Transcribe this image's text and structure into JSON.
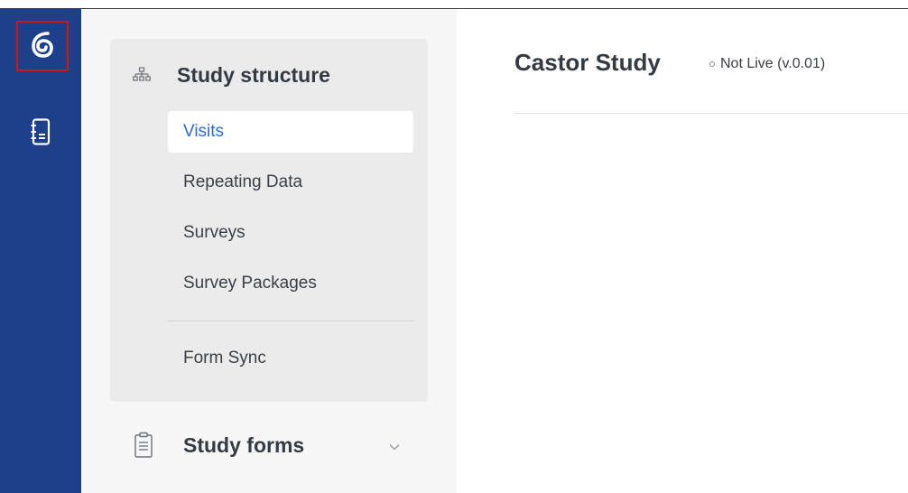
{
  "colors": {
    "rail": "#1e3f8a",
    "accent": "#2f6cd1",
    "highlight_border": "#d0151c"
  },
  "rail": {
    "logo_icon": "castor-swirl-icon",
    "book_icon": "notebook-icon"
  },
  "sidebar": {
    "structure_section": {
      "icon": "sitemap-icon",
      "title": "Study structure",
      "items": [
        {
          "label": "Visits",
          "active": true
        },
        {
          "label": "Repeating Data",
          "active": false
        },
        {
          "label": "Surveys",
          "active": false
        },
        {
          "label": "Survey Packages",
          "active": false
        }
      ],
      "footer_item": {
        "label": "Form Sync"
      }
    },
    "forms_section": {
      "icon": "clipboard-icon",
      "title": "Study forms",
      "chevron": "chevron-down-icon"
    }
  },
  "main": {
    "title": "Castor Study",
    "status": "Not Live (v.0.01)"
  }
}
